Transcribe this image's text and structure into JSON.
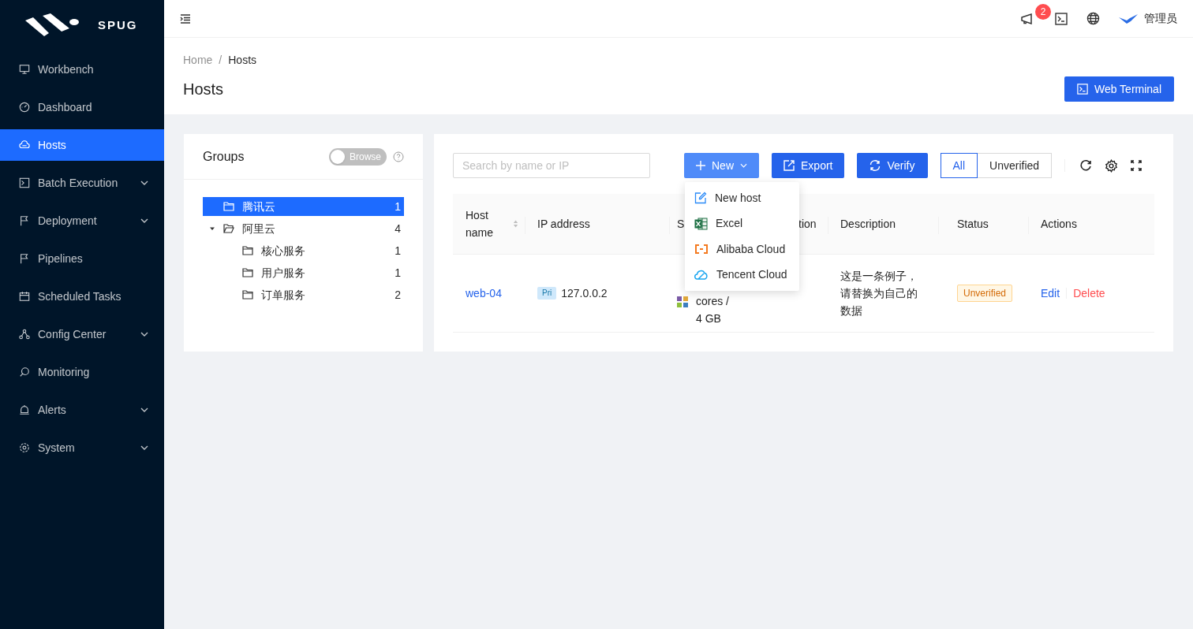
{
  "logo": {
    "text": "SPUG"
  },
  "sidebar": {
    "items": [
      {
        "label": "Workbench",
        "selected": false,
        "expandable": false
      },
      {
        "label": "Dashboard",
        "selected": false,
        "expandable": false
      },
      {
        "label": "Hosts",
        "selected": true,
        "expandable": false
      },
      {
        "label": "Batch Execution",
        "selected": false,
        "expandable": true
      },
      {
        "label": "Deployment",
        "selected": false,
        "expandable": true
      },
      {
        "label": "Pipelines",
        "selected": false,
        "expandable": false
      },
      {
        "label": "Scheduled Tasks",
        "selected": false,
        "expandable": false
      },
      {
        "label": "Config Center",
        "selected": false,
        "expandable": true
      },
      {
        "label": "Monitoring",
        "selected": false,
        "expandable": false
      },
      {
        "label": "Alerts",
        "selected": false,
        "expandable": true
      },
      {
        "label": "System",
        "selected": false,
        "expandable": true
      }
    ]
  },
  "topbar": {
    "notification_count": "2",
    "user": "管理员"
  },
  "breadcrumb": {
    "items": [
      "Home",
      "Hosts"
    ],
    "separator": "/"
  },
  "page_title": "Hosts",
  "web_terminal_button": "Web Terminal",
  "groups": {
    "title": "Groups",
    "browse_toggle": {
      "label": "Browse",
      "on": false
    },
    "tree": [
      {
        "label": "腾讯云",
        "count": "1",
        "selected": true
      },
      {
        "label": "阿里云",
        "count": "4",
        "selected": false,
        "expanded": true,
        "children": [
          {
            "label": "核心服务",
            "count": "1",
            "selected": false
          },
          {
            "label": "用户服务",
            "count": "1",
            "selected": false
          },
          {
            "label": "订单服务",
            "count": "2",
            "selected": false
          }
        ]
      }
    ]
  },
  "toolbar": {
    "search": {
      "placeholder": "Search by name or IP"
    },
    "new_button": "New",
    "export_button": "Export",
    "verify_button": "Verify",
    "filter_tabs": [
      {
        "label": "All",
        "selected": true
      },
      {
        "label": "Unverified",
        "selected": false
      }
    ]
  },
  "new_menu": [
    {
      "label": "New host",
      "kind": "edit"
    },
    {
      "label": "Excel",
      "kind": "excel"
    },
    {
      "label": "Alibaba Cloud",
      "kind": "alibaba"
    },
    {
      "label": "Tencent Cloud",
      "kind": "tencent"
    }
  ],
  "table": {
    "columns": [
      "Host name",
      "IP address",
      "S",
      "tion",
      "Description",
      "Status",
      "Actions"
    ],
    "rows": [
      {
        "host_name": "web-04",
        "ip_tag": "Pri",
        "ip": "127.0.0.2",
        "column_3": [
          "cores /",
          "4 GB"
        ],
        "description": "这是一条例子，请替换为自己的数据",
        "status": "Unverified",
        "actions": [
          "Edit",
          "Delete"
        ]
      }
    ]
  }
}
